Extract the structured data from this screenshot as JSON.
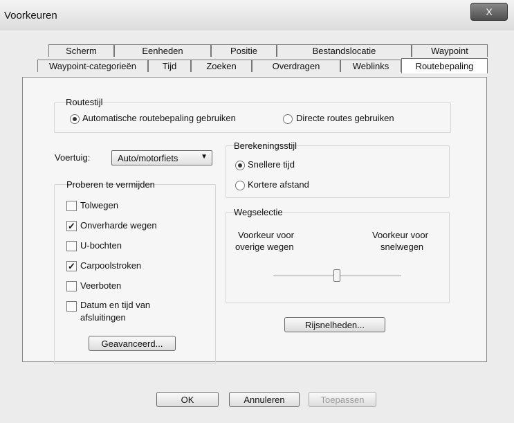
{
  "window": {
    "title": "Voorkeuren",
    "close_label": "X"
  },
  "tabs_row1": [
    "Scherm",
    "Eenheden",
    "Positie",
    "Bestandslocatie",
    "Waypoint"
  ],
  "tabs_row2": [
    "Waypoint-categorieën",
    "Tijd",
    "Zoeken",
    "Overdragen",
    "Weblinks",
    "Routebepaling"
  ],
  "active_tab": "Routebepaling",
  "routestijl": {
    "label": "Routestijl",
    "option_auto": "Automatische routebepaling gebruiken",
    "option_direct": "Directe routes gebruiken",
    "selected": "auto"
  },
  "voertuig": {
    "label": "Voertuig:",
    "value": "Auto/motorfiets"
  },
  "vermijden": {
    "label": "Proberen te vermijden",
    "items": [
      {
        "label": "Tolwegen",
        "checked": false
      },
      {
        "label": "Onverharde wegen",
        "checked": true
      },
      {
        "label": "U-bochten",
        "checked": false
      },
      {
        "label": "Carpoolstroken",
        "checked": true
      },
      {
        "label": "Veerboten",
        "checked": false
      },
      {
        "label": "Datum en tijd van",
        "label2": "afsluitingen",
        "checked": false
      }
    ]
  },
  "geavanceerd_label": "Geavanceerd...",
  "berekening": {
    "label": "Berekeningsstijl",
    "option_fast": "Snellere tijd",
    "option_short": "Kortere afstand",
    "selected": "fast"
  },
  "wegselectie": {
    "label": "Wegselectie",
    "left_line1": "Voorkeur voor",
    "left_line2": "overige wegen",
    "right_line1": "Voorkeur voor",
    "right_line2": "snelwegen",
    "slider_position": 0.5
  },
  "rijsnelheden_label": "Rijsnelheden...",
  "buttons": {
    "ok": "OK",
    "cancel": "Annuleren",
    "apply": "Toepassen"
  },
  "colors": {
    "accent": "#333333",
    "disabled_text": "#9a9a9a"
  }
}
